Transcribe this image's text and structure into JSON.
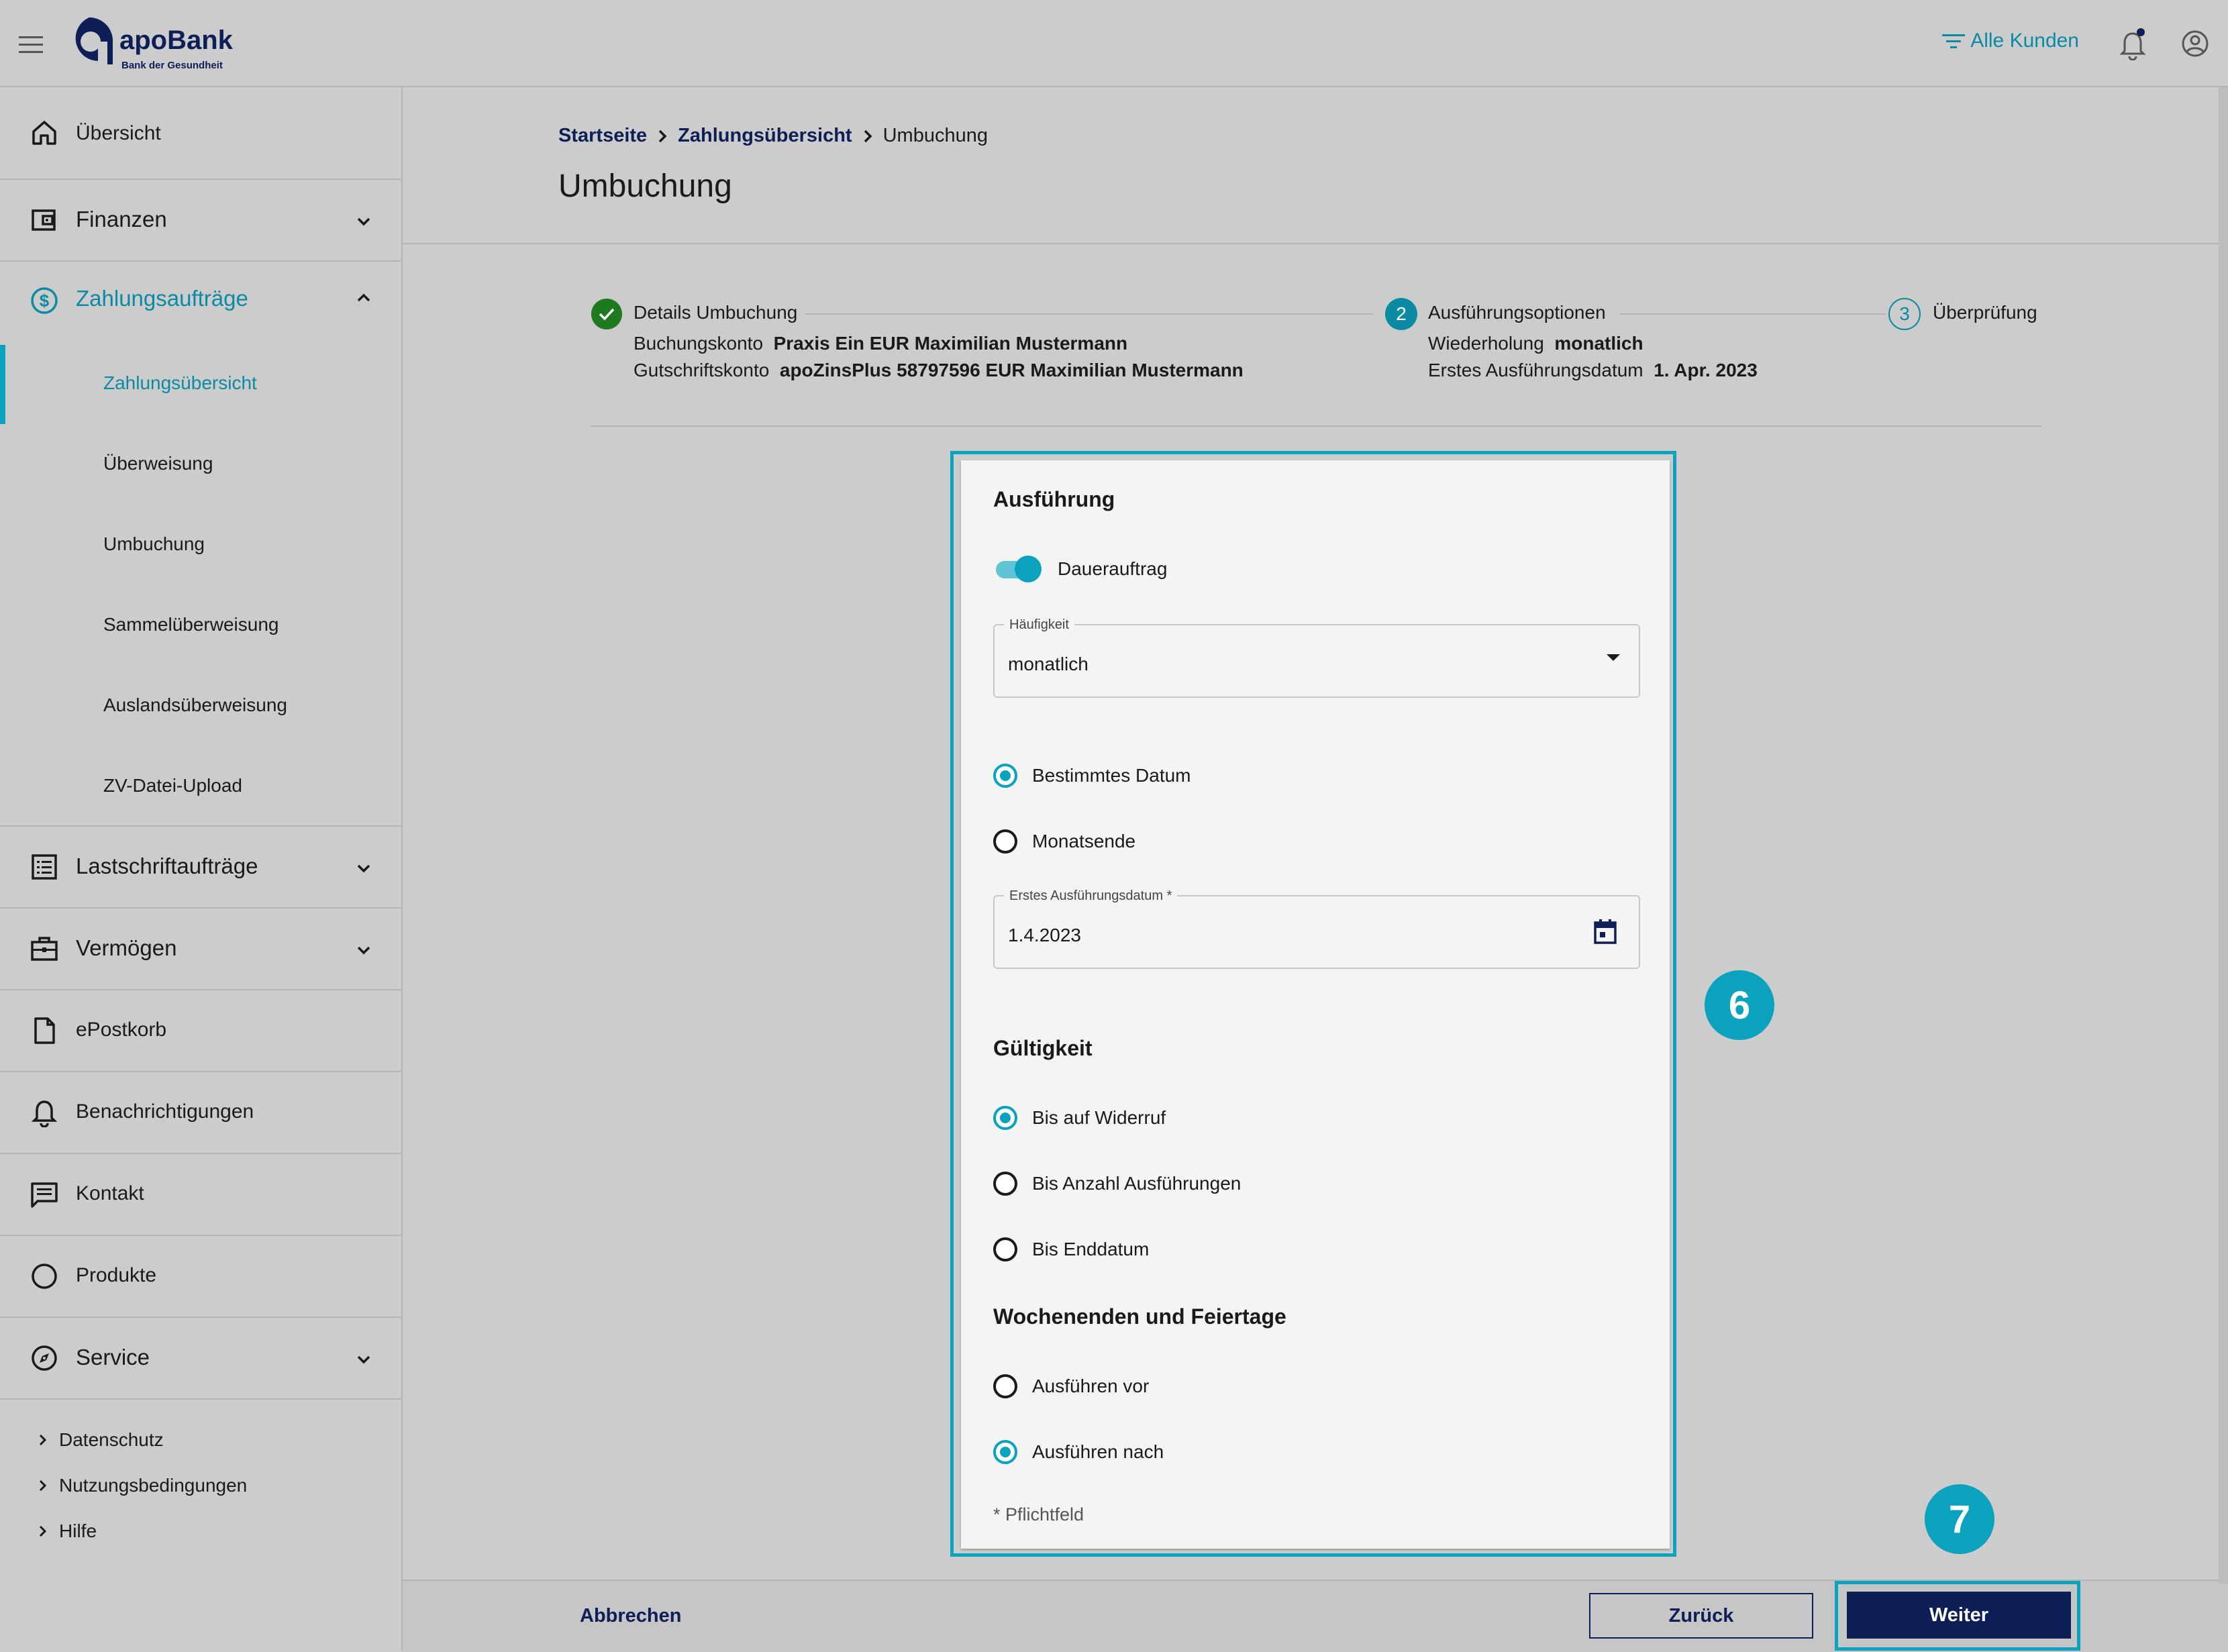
{
  "header": {
    "logo_name": "apoBank",
    "logo_tagline": "Bank der Gesundheit",
    "filter_label": "Alle Kunden",
    "icons": [
      "menu-icon",
      "filter-icon",
      "bell-icon",
      "account-icon"
    ]
  },
  "sidebar": {
    "items": [
      {
        "label": "Übersicht",
        "icon": "home-icon"
      },
      {
        "label": "Finanzen",
        "icon": "wallet-icon"
      },
      {
        "label": "Zahlungsaufträge",
        "icon": "dollar-circle-icon",
        "active": true
      },
      {
        "label": "Lastschriftaufträge",
        "icon": "list-icon"
      },
      {
        "label": "Vermögen",
        "icon": "briefcase-icon"
      },
      {
        "label": "ePostkorb",
        "icon": "document-icon"
      },
      {
        "label": "Benachrichtigungen",
        "icon": "bell-icon"
      },
      {
        "label": "Kontakt",
        "icon": "message-icon"
      },
      {
        "label": "Produkte",
        "icon": "circle-icon"
      },
      {
        "label": "Service",
        "icon": "compass-icon"
      }
    ],
    "subitems": [
      {
        "label": "Zahlungsübersicht",
        "active": true
      },
      {
        "label": "Überweisung"
      },
      {
        "label": "Umbuchung"
      },
      {
        "label": "Sammelüberweisung"
      },
      {
        "label": "Auslandsüberweisung"
      },
      {
        "label": "ZV-Datei-Upload"
      }
    ],
    "footer_links": [
      "Datenschutz",
      "Nutzungsbedingungen",
      "Hilfe"
    ]
  },
  "breadcrumb": {
    "items": [
      "Startseite",
      "Zahlungsübersicht",
      "Umbuchung"
    ]
  },
  "page_title": "Umbuchung",
  "stepper": {
    "steps": [
      {
        "number": "1",
        "title": "Details Umbuchung",
        "status": "done",
        "details": [
          {
            "label": "Buchungskonto",
            "value": "Praxis Ein EUR Maximilian Mustermann"
          },
          {
            "label": "Gutschriftskonto",
            "value": "apoZinsPlus 58797596 EUR Maximilian Mustermann"
          }
        ]
      },
      {
        "number": "2",
        "title": "Ausführungsoptionen",
        "status": "active",
        "details": [
          {
            "label": "Wiederholung",
            "value": "monatlich"
          },
          {
            "label": "Erstes Ausführungsdatum",
            "value": "1. Apr. 2023"
          }
        ]
      },
      {
        "number": "3",
        "title": "Überprüfung",
        "status": "pending"
      }
    ]
  },
  "form": {
    "section_execution": "Ausführung",
    "toggle_label": "Dauerauftrag",
    "toggle_on": true,
    "frequency": {
      "label": "Häufigkeit",
      "value": "monatlich"
    },
    "date_mode_options": [
      {
        "label": "Bestimmtes Datum",
        "selected": true
      },
      {
        "label": "Monatsende",
        "selected": false
      }
    ],
    "first_date": {
      "label": "Erstes Ausführungsdatum *",
      "value": "1.4.2023"
    },
    "section_validity": "Gültigkeit",
    "validity_options": [
      {
        "label": "Bis auf Widerruf",
        "selected": true
      },
      {
        "label": "Bis Anzahl Ausführungen",
        "selected": false
      },
      {
        "label": "Bis Enddatum",
        "selected": false
      }
    ],
    "section_weekend": "Wochenenden und Feiertage",
    "weekend_options": [
      {
        "label": "Ausführen vor",
        "selected": false
      },
      {
        "label": "Ausführen nach",
        "selected": true
      }
    ],
    "required_note": "* Pflichtfeld"
  },
  "annotations": {
    "badge_form": "6",
    "badge_next": "7"
  },
  "actions": {
    "cancel": "Abbrechen",
    "back": "Zurück",
    "next": "Weiter"
  },
  "colors": {
    "accent": "#0aa2bd",
    "navy": "#0d1f56",
    "success": "#1e7a1e",
    "background": "#cccccc"
  }
}
